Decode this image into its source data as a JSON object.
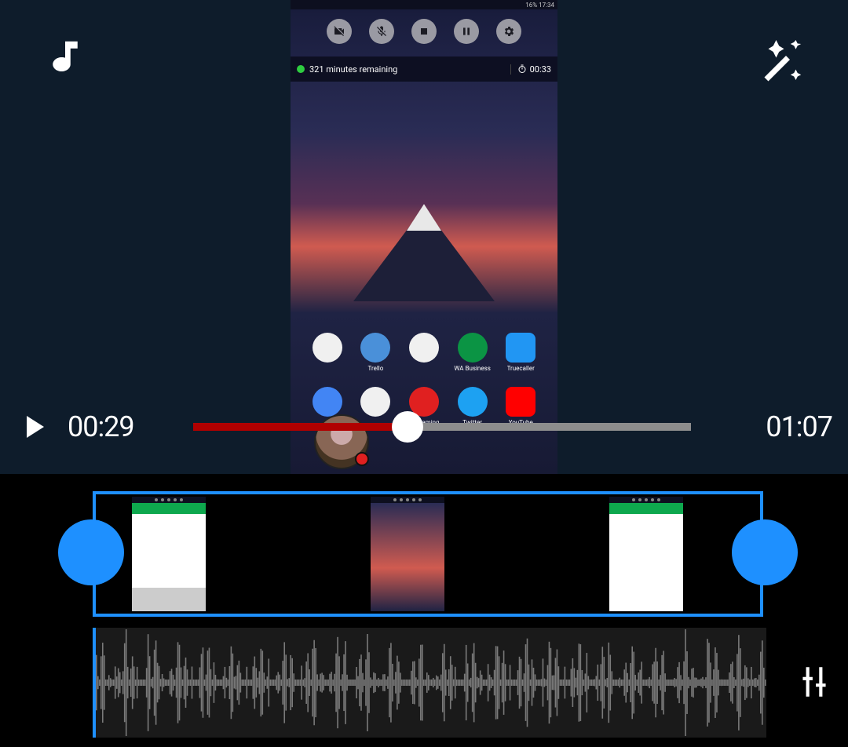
{
  "status_bar_text": "16%  17:34",
  "banner": {
    "remaining_text": "321 minutes remaining",
    "elapsed_text": "00:33"
  },
  "apps": [
    {
      "label": "",
      "shape": "round",
      "color": "#f0f0f0"
    },
    {
      "label": "Trello",
      "shape": "round",
      "color": "#4a90d9"
    },
    {
      "label": "",
      "shape": "round",
      "color": "#f0f0f0"
    },
    {
      "label": "WA Business",
      "shape": "round",
      "color": "#0b9444"
    },
    {
      "label": "Truecaller",
      "shape": "sq",
      "color": "#2196f3"
    },
    {
      "label": "",
      "shape": "round",
      "color": "#4285f4"
    },
    {
      "label": "",
      "shape": "round",
      "color": "#f0f0f0"
    },
    {
      "label": "YT Gaming",
      "shape": "round",
      "color": "#e02020"
    },
    {
      "label": "Twitter",
      "shape": "round",
      "color": "#1da1f2"
    },
    {
      "label": "YouTube",
      "shape": "sq",
      "color": "#ff0000"
    }
  ],
  "player": {
    "current_time": "00:29",
    "total_time": "01:07",
    "progress_percent": 43
  },
  "colors": {
    "accent": "#1e90ff",
    "seek_fill": "#b00000"
  }
}
